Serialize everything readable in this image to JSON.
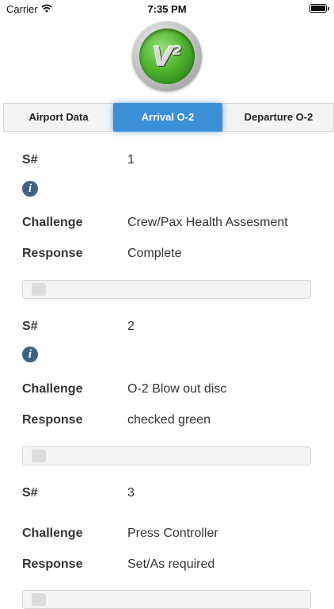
{
  "status_bar": {
    "carrier": "Carrier",
    "time": "7:35 PM"
  },
  "logo": {
    "letter": "V",
    "superscript": "2"
  },
  "tabs": [
    {
      "label": "Airport Data",
      "selected": false
    },
    {
      "label": "Arrival O-2",
      "selected": true
    },
    {
      "label": "Departure O-2",
      "selected": false
    }
  ],
  "labels": {
    "sn": "S#",
    "challenge": "Challenge",
    "response": "Response"
  },
  "items": [
    {
      "sn": "1",
      "challenge": "Crew/Pax Health Assesment",
      "response": "Complete"
    },
    {
      "sn": "2",
      "challenge": "O-2 Blow out disc",
      "response": "checked green"
    },
    {
      "sn": "3",
      "challenge": "Press Controller",
      "response": "Set/As required"
    }
  ],
  "icons": {
    "info": "info-icon",
    "wifi": "wifi-icon",
    "battery": "battery-icon"
  },
  "colors": {
    "accent": "#3a8fd6",
    "info": "#3f6283"
  }
}
